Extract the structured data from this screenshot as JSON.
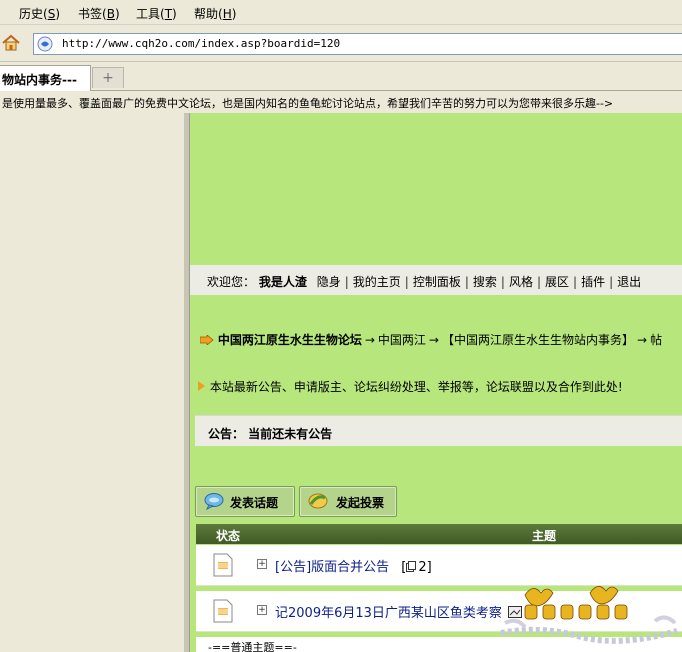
{
  "menu": [
    {
      "label": "历史",
      "accel": "S"
    },
    {
      "label": "书签",
      "accel": "B"
    },
    {
      "label": "工具",
      "accel": "T"
    },
    {
      "label": "帮助",
      "accel": "H"
    }
  ],
  "address": {
    "url": "http://www.cqh2o.com/index.asp?boardid=120"
  },
  "tab": {
    "label": "物站内事务---",
    "new_tab_glyph": "+"
  },
  "ticker": "是使用量最多、覆盖面最广的免费中文论坛，也是国内知名的鱼龟蛇讨论站点，希望我们辛苦的努力可以为您带来很多乐趣-->",
  "userbar": {
    "welcome": "欢迎您：",
    "username": "我是人渣",
    "links": [
      "隐身",
      "我的主页",
      "控制面板",
      "搜索",
      "风格",
      "展区",
      "插件",
      "退出"
    ]
  },
  "breadcrumb": {
    "forum": "中国两江原生水生生物论坛",
    "items": [
      "中国两江",
      "【中国两江原生水生生物站内事务】",
      "帖"
    ]
  },
  "notice": "本站最新公告、申请版主、论坛纠纷处理、举报等，论坛联盟以及合作到此处!",
  "announcement": "公告： 当前还未有公告",
  "buttons": {
    "post_topic": "发表话题",
    "post_poll": "发起投票"
  },
  "table": {
    "headers": {
      "status": "状态",
      "topic": "主题"
    },
    "rows": [
      {
        "title": "[公告]版面合并公告",
        "replies": "2"
      },
      {
        "title": "记2009年6月13日广西某山区鱼类考察",
        "replies": ""
      }
    ],
    "section_label": "-==普通主题==-"
  },
  "colors": {
    "chrome": "#ece9d8",
    "content_bg": "#b7e67c",
    "header_green": "#4b6a2e",
    "link_blue": "#0b1f8a"
  }
}
